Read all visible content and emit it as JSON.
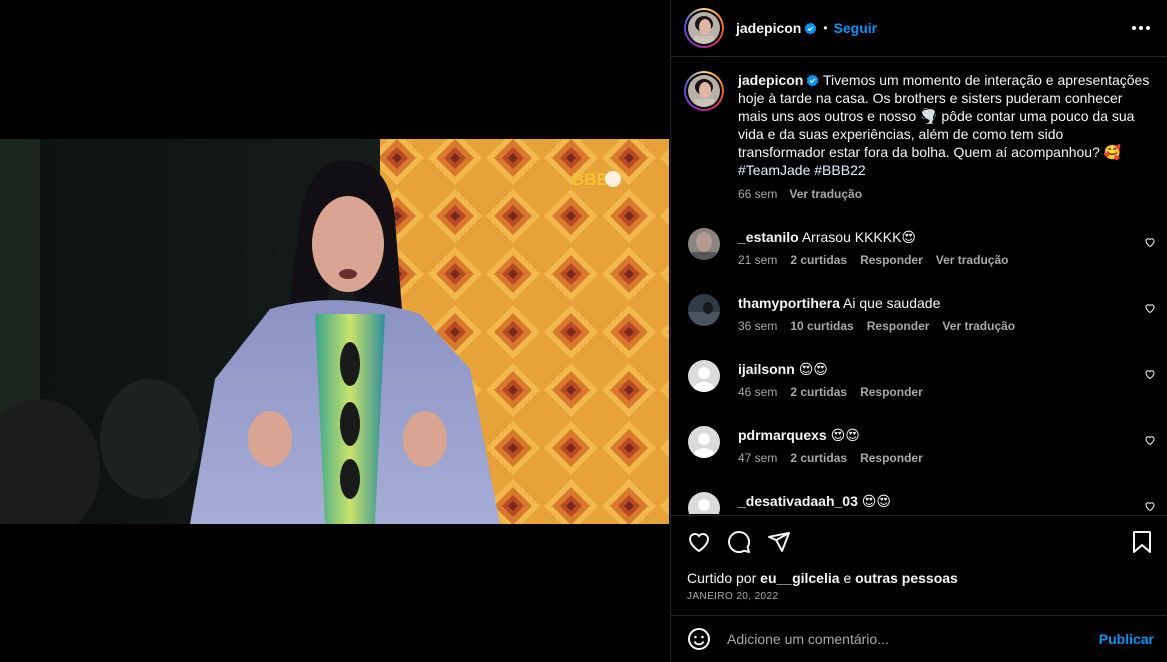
{
  "post": {
    "author": "jadepicon",
    "verified": true,
    "follow_label": "Seguir",
    "dot": "•",
    "video": {
      "watermark": "BBB",
      "muted": true
    }
  },
  "caption": {
    "author": "jadepicon",
    "text": "Tivemos um momento de interação e apresentações hoje à tarde na casa. Os brothers e sisters puderam conhecer mais uns aos outros e nosso 🌪️ pôde contar uma pouco da sua vida e da suas experiências, além de como tem sido transformador estar fora da bolha. Quem aí acompanhou? 🥰",
    "hashtags": "#TeamJade #BBB22",
    "time": "66 sem",
    "translate_label": "Ver tradução"
  },
  "comments": [
    {
      "user": "_estanilo",
      "text": "Arrasou KKKKK😍",
      "time": "21 sem",
      "likes": "2 curtidas",
      "reply": "Responder",
      "translate": "Ver tradução"
    },
    {
      "user": "thamyportihera",
      "text": "Ai que saudade",
      "time": "36 sem",
      "likes": "10 curtidas",
      "reply": "Responder",
      "translate": "Ver tradução"
    },
    {
      "user": "ijailsonn",
      "text": "😍😍",
      "time": "46 sem",
      "likes": "2 curtidas",
      "reply": "Responder"
    },
    {
      "user": "pdrmarquexs",
      "text": "😍😍",
      "time": "47 sem",
      "likes": "2 curtidas",
      "reply": "Responder"
    },
    {
      "user": "_desativadaah_03",
      "text": "😍😍",
      "time": "",
      "likes": "",
      "reply": ""
    }
  ],
  "liked_by": {
    "prefix": "Curtido por",
    "user": "eu__gilcelia",
    "connector": "e",
    "others": "outras pessoas"
  },
  "date": "JANEIRO 20, 2022",
  "add_comment": {
    "placeholder": "Adicione um comentário...",
    "publish_label": "Publicar"
  },
  "colors": {
    "accent": "#0095f6",
    "secondary_text": "#a8a8a8",
    "divider": "#262626"
  }
}
